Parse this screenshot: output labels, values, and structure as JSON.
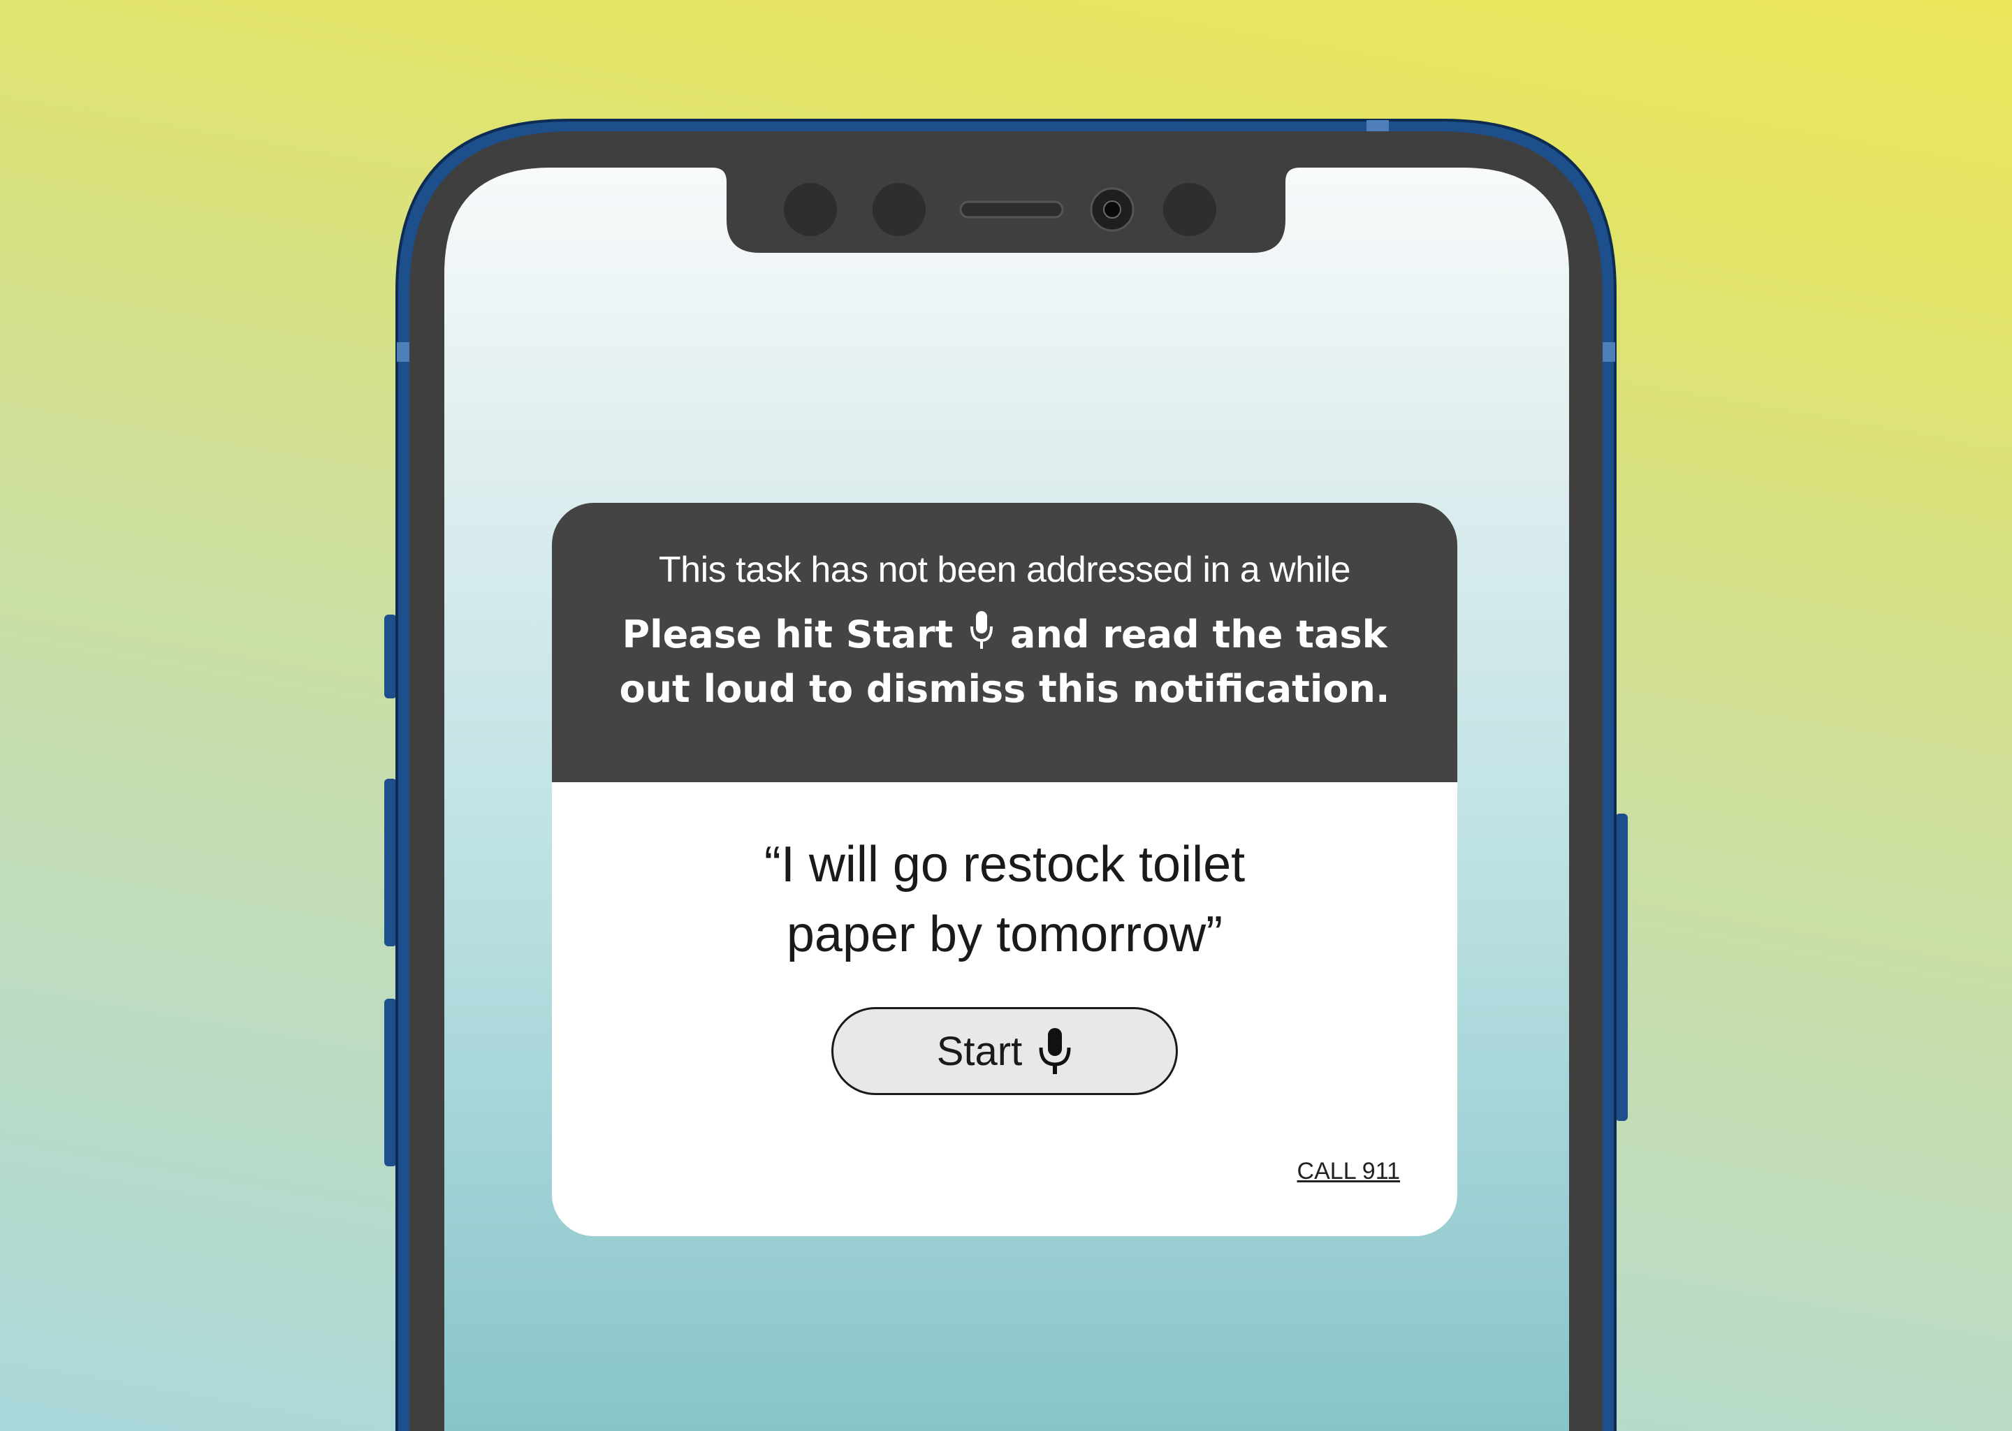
{
  "colors": {
    "background_top": "#ece65c",
    "background_bottom": "#aad8dc",
    "phone_frame": "#1c4f8c",
    "phone_bezel": "#3f3f3f",
    "screen_top": "#f8fafb",
    "screen_bottom": "#86c4c9",
    "card_header": "#444444",
    "card_body": "#ffffff",
    "button_fill": "#e8e8e8"
  },
  "phone": {
    "notch_icons": [
      "sensor-dot-icon",
      "sensor-dot-icon",
      "speaker-grille-icon",
      "front-camera-icon",
      "sensor-dot-icon"
    ]
  },
  "notification": {
    "subtitle": "This task has not been addressed in a while",
    "message_part1": "Please hit Start",
    "message_icon": "microphone-icon",
    "message_part2": " and read the task out loud to dismiss this notification.",
    "task_quote_line1": "“I will go restock toilet",
    "task_quote_line2": "paper by tomorrow”",
    "start_button_label": "Start",
    "start_button_icon": "microphone-icon",
    "emergency_link": "CALL 911"
  }
}
